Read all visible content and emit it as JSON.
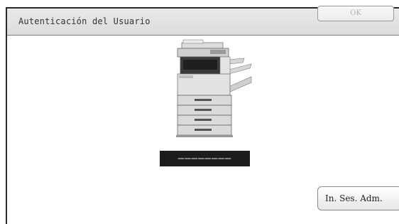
{
  "dialog": {
    "title": "Autenticación del Usuario",
    "ok_label": "OK",
    "code_display": "––––––––",
    "admin_login_label": "In. Ses. Adm.",
    "device_image": "multifunction-printer-image"
  }
}
